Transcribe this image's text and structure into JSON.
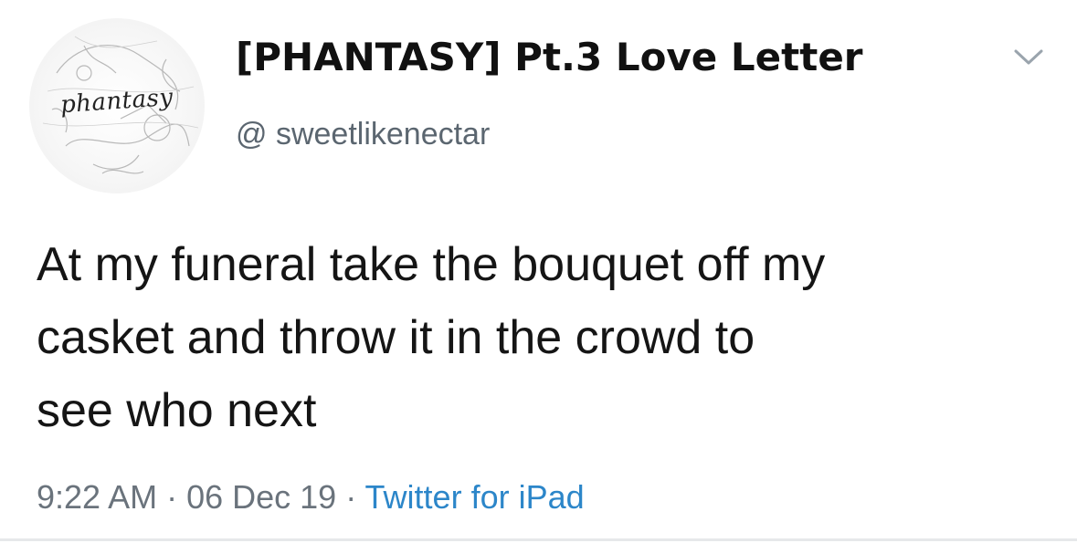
{
  "tweet": {
    "avatar": {
      "icon": "phantasy-logo-avatar",
      "logo_text": "phantasy"
    },
    "display_name": "[PHANTASY] Pt.3 Love Letter",
    "handle": "@ sweetlikenectar",
    "menu_icon": "chevron-down-icon",
    "body_lines": [
      "At my funeral take the bouquet off my",
      "casket and throw it in the crowd to",
      "see who next"
    ],
    "time": "9:22 AM",
    "separator": " · ",
    "date": "06 Dec 19",
    "source": "Twitter for iPad"
  },
  "colors": {
    "text": "#151515",
    "secondary": "#6a737c",
    "link": "#2c86c9"
  }
}
